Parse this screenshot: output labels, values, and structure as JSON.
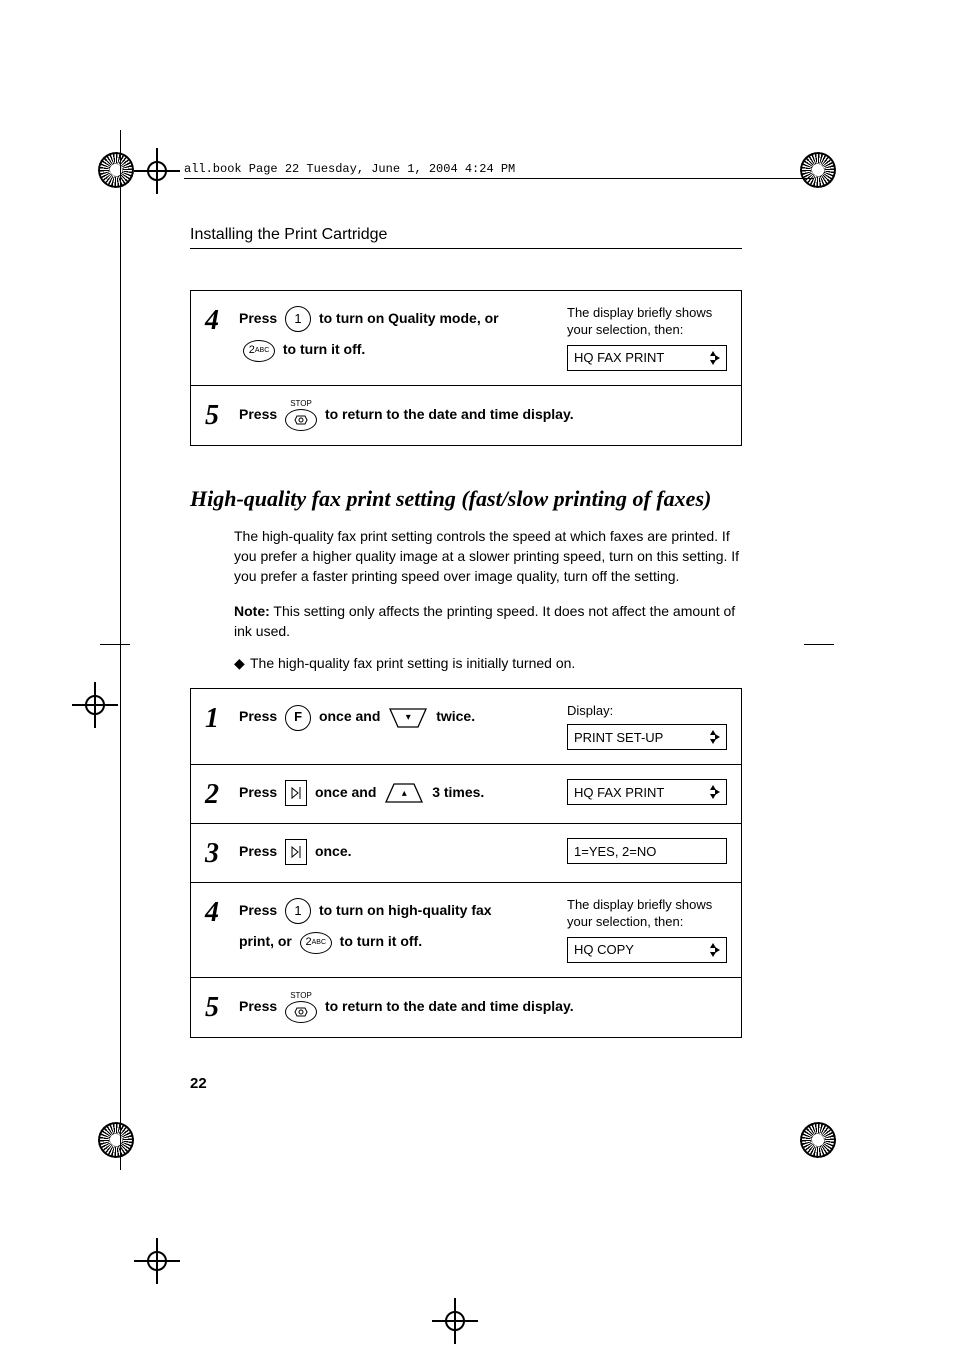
{
  "meta_line": "all.book  Page 22  Tuesday, June 1, 2004  4:24 PM",
  "header": "Installing the Print Cartridge",
  "page_number": "22",
  "icons": {
    "stop_label": "STOP"
  },
  "top_steps": {
    "s4": {
      "num": "4",
      "line1_a": "Press ",
      "line1_b": " to turn on Quality mode, or",
      "line2_a": "",
      "line2_b": " to turn it off.",
      "hint": "The display briefly shows your selection, then:",
      "lcd": "HQ FAX PRINT"
    },
    "s5": {
      "num": "5",
      "line_a": "Press ",
      "line_b": " to return to the date and time display."
    }
  },
  "section_heading": "High-quality fax print setting (fast/slow printing of faxes)",
  "para1": "The high-quality fax print setting controls the speed at which faxes are printed. If you prefer a higher quality image at a slower printing speed, turn on this setting. If you prefer a faster printing speed over image quality, turn off the setting.",
  "note_label": "Note:",
  "note_body": " This setting only affects the printing speed. It does not affect the amount of ink used.",
  "bullet": "The high-quality fax print setting is initially turned on.",
  "bottom_steps": {
    "s1": {
      "num": "1",
      "a": "Press ",
      "b": " once and ",
      "c": " twice.",
      "display_label": "Display:",
      "lcd": "PRINT SET-UP"
    },
    "s2": {
      "num": "2",
      "a": "Press ",
      "b": " once and ",
      "c": " 3 times.",
      "lcd": "HQ FAX PRINT"
    },
    "s3": {
      "num": "3",
      "a": "Press ",
      "b": " once.",
      "lcd": "1=YES, 2=NO"
    },
    "s4": {
      "num": "4",
      "l1a": "Press ",
      "l1b": " to turn on high-quality fax",
      "l2a": "print, or ",
      "l2b": " to turn it off.",
      "hint": "The display briefly shows your selection, then:",
      "lcd": "HQ COPY"
    },
    "s5": {
      "num": "5",
      "a": "Press ",
      "b": " to return to the date and time display."
    }
  }
}
